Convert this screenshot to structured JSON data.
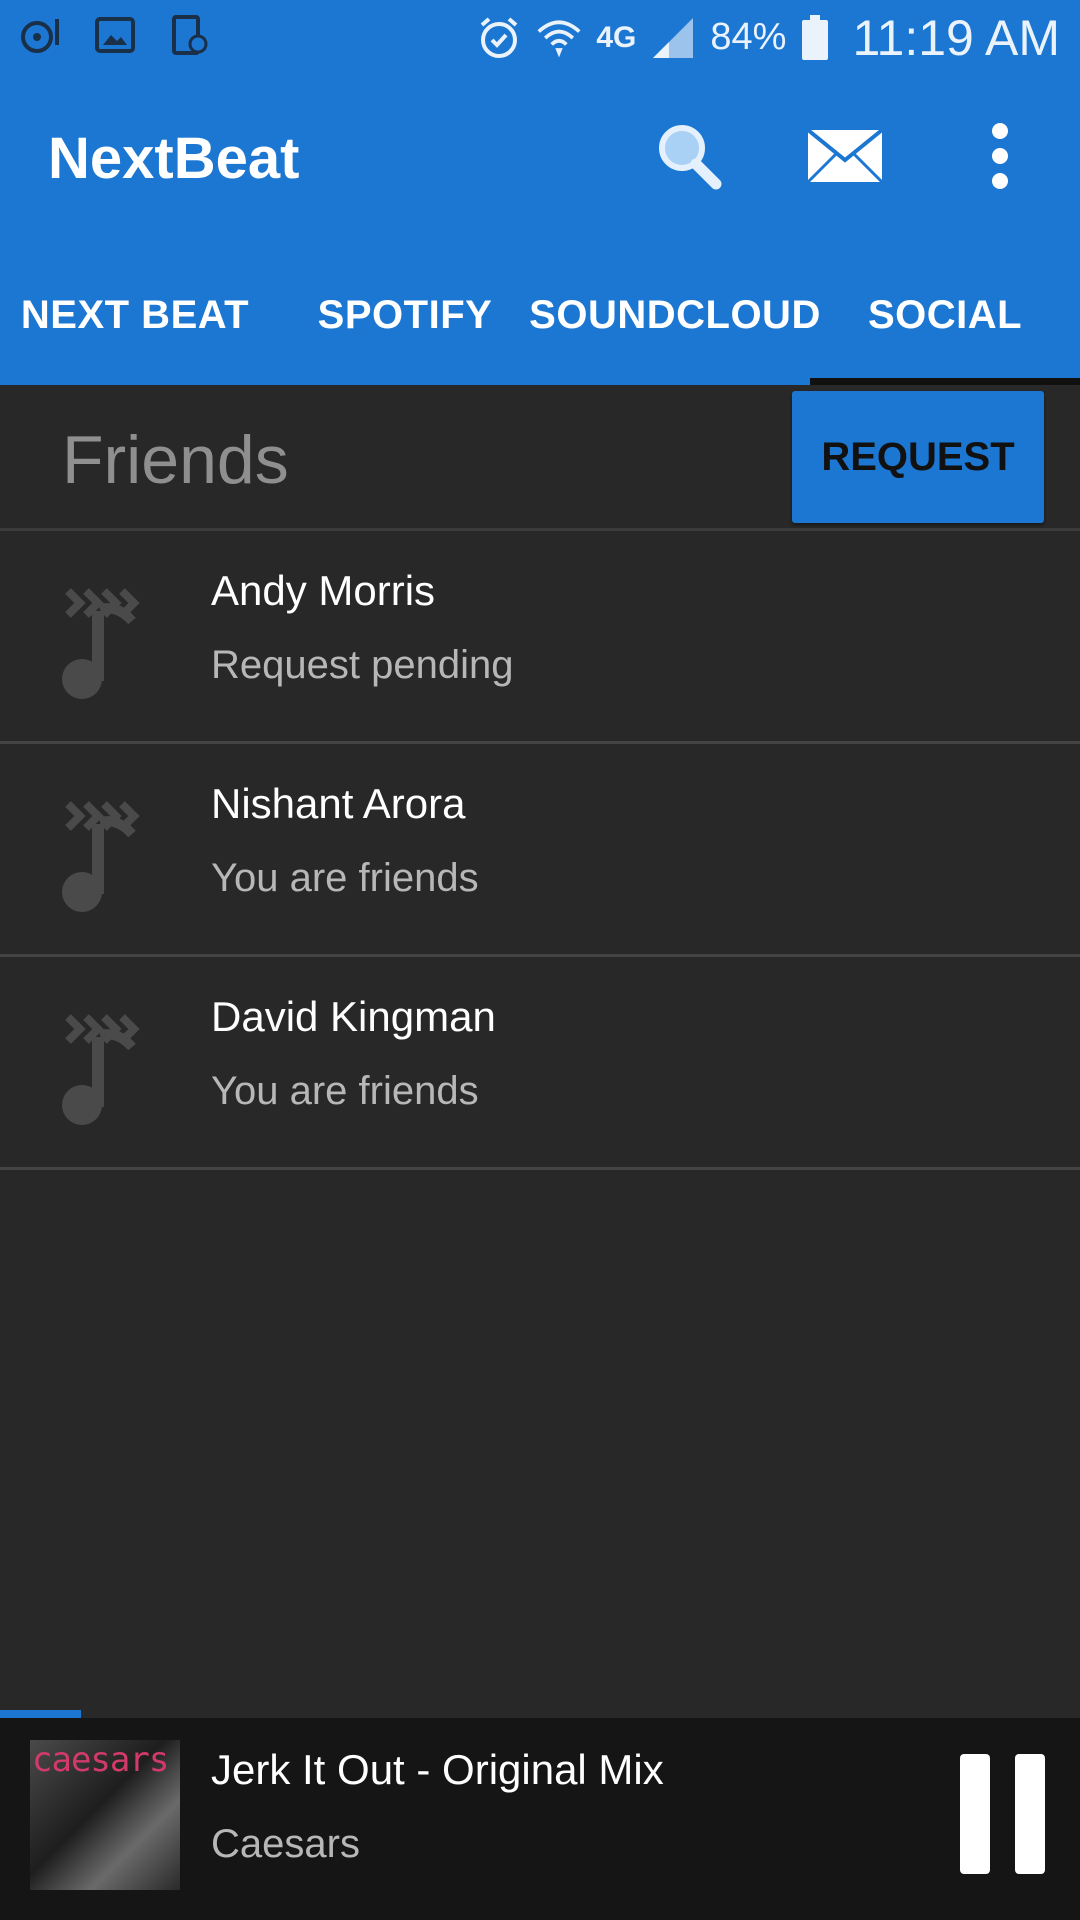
{
  "status_bar": {
    "battery": "84%",
    "time": "11:19 AM",
    "network": "4G"
  },
  "app_bar": {
    "title": "NextBeat"
  },
  "tabs": [
    {
      "label": "NEXT BEAT"
    },
    {
      "label": "SPOTIFY"
    },
    {
      "label": "SOUNDCLOUD"
    },
    {
      "label": "SOCIAL",
      "selected": true
    }
  ],
  "friends": {
    "title": "Friends",
    "request_label": "REQUEST",
    "items": [
      {
        "name": "Andy Morris",
        "status": "Request pending"
      },
      {
        "name": "Nishant Arora",
        "status": "You are friends"
      },
      {
        "name": "David Kingman",
        "status": "You are friends"
      }
    ]
  },
  "player": {
    "track": "Jerk It Out - Original Mix",
    "artist": "Caesars",
    "album_text": "caesars",
    "progress_fraction": 0.075
  },
  "colors": {
    "primary": "#1c77d2",
    "background": "#282828",
    "player_bg": "#151515"
  }
}
